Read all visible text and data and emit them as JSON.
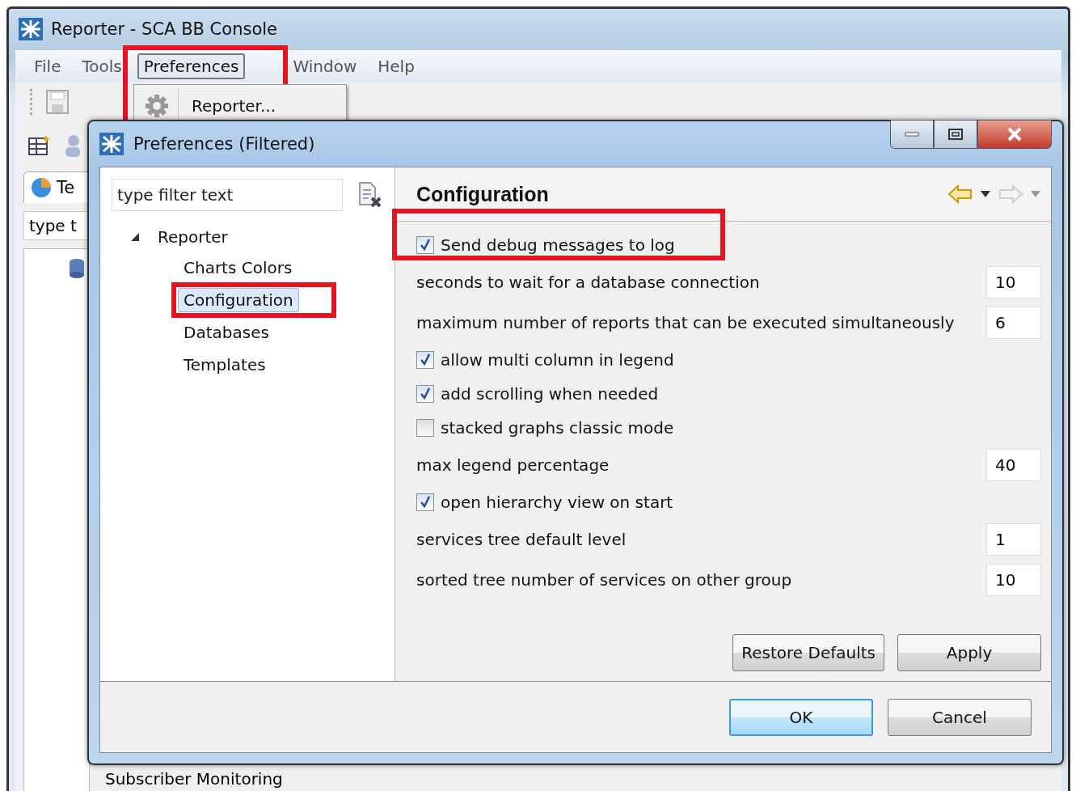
{
  "window": {
    "title": "Reporter - SCA BB Console"
  },
  "menu": [
    {
      "label": "File",
      "selected": false
    },
    {
      "label": "Tools",
      "selected": false
    },
    {
      "label": "Preferences",
      "selected": true,
      "highlighted": true
    },
    {
      "label": "Window",
      "selected": false
    },
    {
      "label": "Help",
      "selected": false
    }
  ],
  "menu_dropdown": [
    {
      "label": "Reporter..."
    }
  ],
  "background_panel": {
    "tab": "Te",
    "filter_value": "type t",
    "list_items": [
      "Subscriber Monitoring"
    ]
  },
  "dialog": {
    "title": "Preferences (Filtered)",
    "filter": {
      "placeholder": "type filter text"
    },
    "tree": [
      {
        "label": "Reporter",
        "expanded": true,
        "selected": false,
        "children": [
          {
            "label": "Charts Colors",
            "selected": false
          },
          {
            "label": "Configuration",
            "selected": true,
            "highlighted": true
          },
          {
            "label": "Databases",
            "selected": false
          },
          {
            "label": "Templates",
            "selected": false
          }
        ]
      }
    ],
    "page_title": "Configuration",
    "nav": {
      "back_enabled": true,
      "forward_enabled": false
    },
    "settings": [
      {
        "kind": "checkbox",
        "label": "Send debug messages to log",
        "checked": true,
        "highlighted": true
      },
      {
        "kind": "number",
        "label": "seconds to wait for a database connection",
        "value": "10"
      },
      {
        "kind": "number",
        "label": "maximum number of reports that can be executed simultaneously",
        "value": "6"
      },
      {
        "kind": "checkbox",
        "label": "allow multi column in legend",
        "checked": true
      },
      {
        "kind": "checkbox",
        "label": "add scrolling when needed",
        "checked": true
      },
      {
        "kind": "checkbox",
        "label": "stacked graphs classic mode",
        "checked": false
      },
      {
        "kind": "number",
        "label": "max legend percentage",
        "value": "40"
      },
      {
        "kind": "checkbox",
        "label": "open hierarchy view on start",
        "checked": true
      },
      {
        "kind": "number",
        "label": "services tree default level",
        "value": "1"
      },
      {
        "kind": "number",
        "label": "sorted tree number of services on other group",
        "value": "10"
      }
    ],
    "page_buttons": [
      "Restore Defaults",
      "Apply"
    ],
    "buttons": [
      {
        "label": "OK",
        "default": true
      },
      {
        "label": "Cancel",
        "default": false
      }
    ]
  }
}
